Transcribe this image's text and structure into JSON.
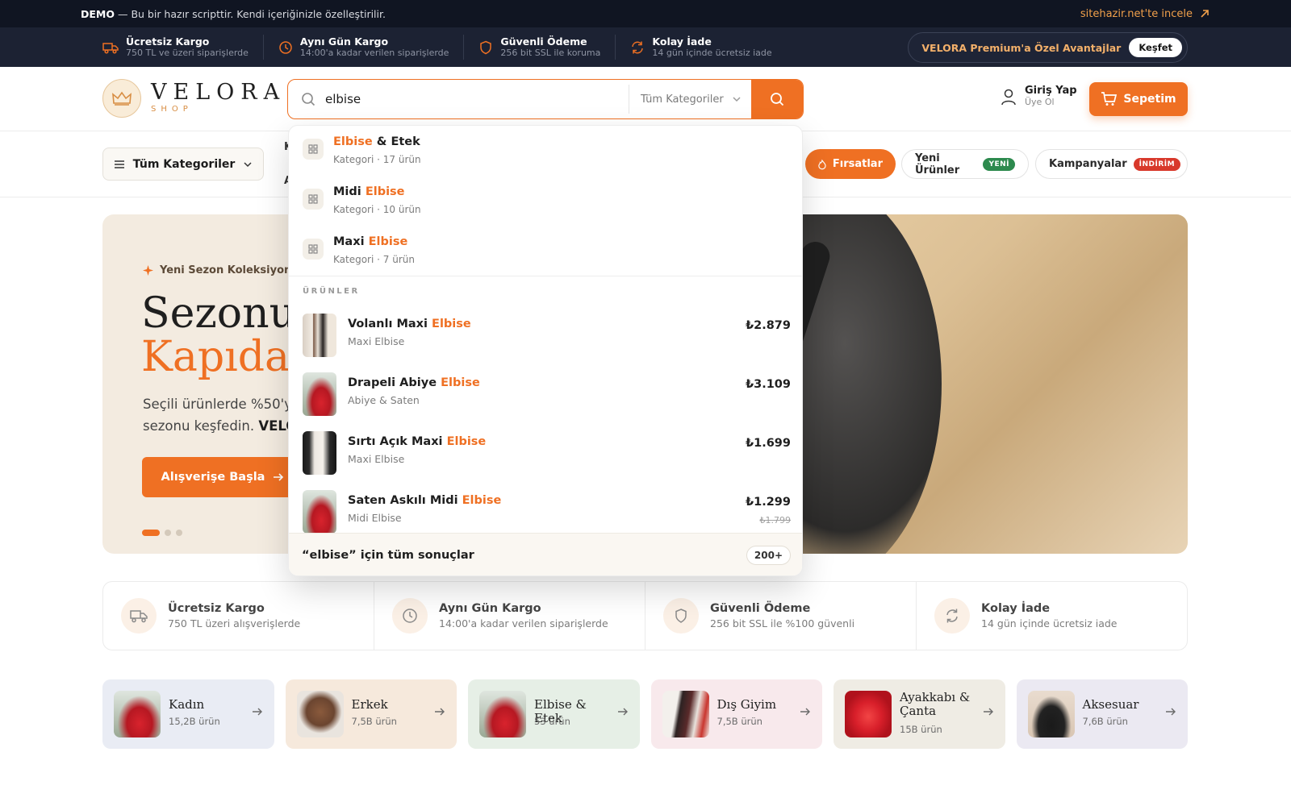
{
  "demo_bar": {
    "tag": "DEMO",
    "text": "— Bu bir hazır scripttir. Kendi içeriğinizle özelleştirilir.",
    "link": "sitehazir.net'te incele"
  },
  "usp_strip": [
    {
      "icon": "truck-icon",
      "title": "Ücretsiz Kargo",
      "sub": "750 TL ve üzeri siparişlerde"
    },
    {
      "icon": "clock-icon",
      "title": "Aynı Gün Kargo",
      "sub": "14:00'a kadar verilen siparişlerde"
    },
    {
      "icon": "shield-icon",
      "title": "Güvenli Ödeme",
      "sub": "256 bit SSL ile koruma"
    },
    {
      "icon": "refresh-icon",
      "title": "Kolay İade",
      "sub": "14 gün içinde ücretsiz iade"
    }
  ],
  "premium": {
    "text": "VELORA Premium'a Özel Avantajlar",
    "button": "Keşfet"
  },
  "logo": {
    "word": "VELORA",
    "sub": "SHOP"
  },
  "search": {
    "value": "elbise",
    "category": "Tüm Kategoriler"
  },
  "account": {
    "title": "Giriş Yap",
    "sub": "Üye Ol"
  },
  "cart": {
    "label": "Sepetim"
  },
  "nav": {
    "all_categories": "Tüm Kategoriler",
    "peek_1": "K",
    "peek_2": "A",
    "deals": "Fırsatlar",
    "new_products": "Yeni Ürünler",
    "new_badge": "YENİ",
    "campaigns": "Kampanyalar",
    "campaigns_badge": "İNDİRİM"
  },
  "hero": {
    "kicker": "Yeni Sezon Koleksiyonu",
    "title_line1": "Sezonun",
    "title_line2": "Kapıda",
    "text_1": "Seçili ürünlerde %50'ye k",
    "text_2": "sezonu keşfedin. ",
    "text_brand": "VELOR",
    "cta": "Alışverişe Başla"
  },
  "dropdown": {
    "categories": [
      {
        "prefix": "",
        "highlight": "Elbise",
        "suffix": " & Etek",
        "meta": "Kategori · 17 ürün"
      },
      {
        "prefix": "Midi ",
        "highlight": "Elbise",
        "suffix": "",
        "meta": "Kategori · 10 ürün"
      },
      {
        "prefix": "Maxi ",
        "highlight": "Elbise",
        "suffix": "",
        "meta": "Kategori · 7 ürün"
      }
    ],
    "products_title": "ÜRÜNLER",
    "products": [
      {
        "prefix": "Volanlı Maxi ",
        "highlight": "Elbise",
        "category": "Maxi Elbise",
        "price": "₺2.879",
        "old_price": ""
      },
      {
        "prefix": "Drapeli Abiye ",
        "highlight": "Elbise",
        "category": "Abiye & Saten",
        "price": "₺3.109",
        "old_price": ""
      },
      {
        "prefix": "Sırtı Açık Maxi ",
        "highlight": "Elbise",
        "category": "Maxi Elbise",
        "price": "₺1.699",
        "old_price": ""
      },
      {
        "prefix": "Saten Askılı Midi ",
        "highlight": "Elbise",
        "category": "Midi Elbise",
        "price": "₺1.299",
        "old_price": "₺1.799"
      }
    ],
    "footer": "“elbise” için tüm sonuçlar",
    "footer_count": "200+"
  },
  "features": [
    {
      "icon": "truck-icon",
      "title": "Ücretsiz Kargo",
      "sub": "750 TL üzeri alışverişlerde"
    },
    {
      "icon": "clock-icon",
      "title": "Aynı Gün Kargo",
      "sub": "14:00'a kadar verilen siparişlerde"
    },
    {
      "icon": "shield-icon",
      "title": "Güvenli Ödeme",
      "sub": "256 bit SSL ile %100 güvenli"
    },
    {
      "icon": "refresh-icon",
      "title": "Kolay İade",
      "sub": "14 gün içinde ücretsiz iade"
    }
  ],
  "category_cards": [
    {
      "name": "Kadın",
      "count": "15,2B ürün",
      "bg": "#e9ecf4"
    },
    {
      "name": "Erkek",
      "count": "7,5B ürün",
      "bg": "#f6e9dc"
    },
    {
      "name": "Elbise & Etek",
      "count": "53 ürün",
      "bg": "#e6efe6"
    },
    {
      "name": "Dış Giyim",
      "count": "7,5B ürün",
      "bg": "#f8e9ec"
    },
    {
      "name": "Ayakkabı & Çanta",
      "count": "15B ürün",
      "bg": "#efece4"
    },
    {
      "name": "Aksesuar",
      "count": "7,6B ürün",
      "bg": "#ebe9f2"
    }
  ],
  "colors": {
    "accent": "#ef7023",
    "dark": "#101522",
    "strip": "#1c2233"
  }
}
